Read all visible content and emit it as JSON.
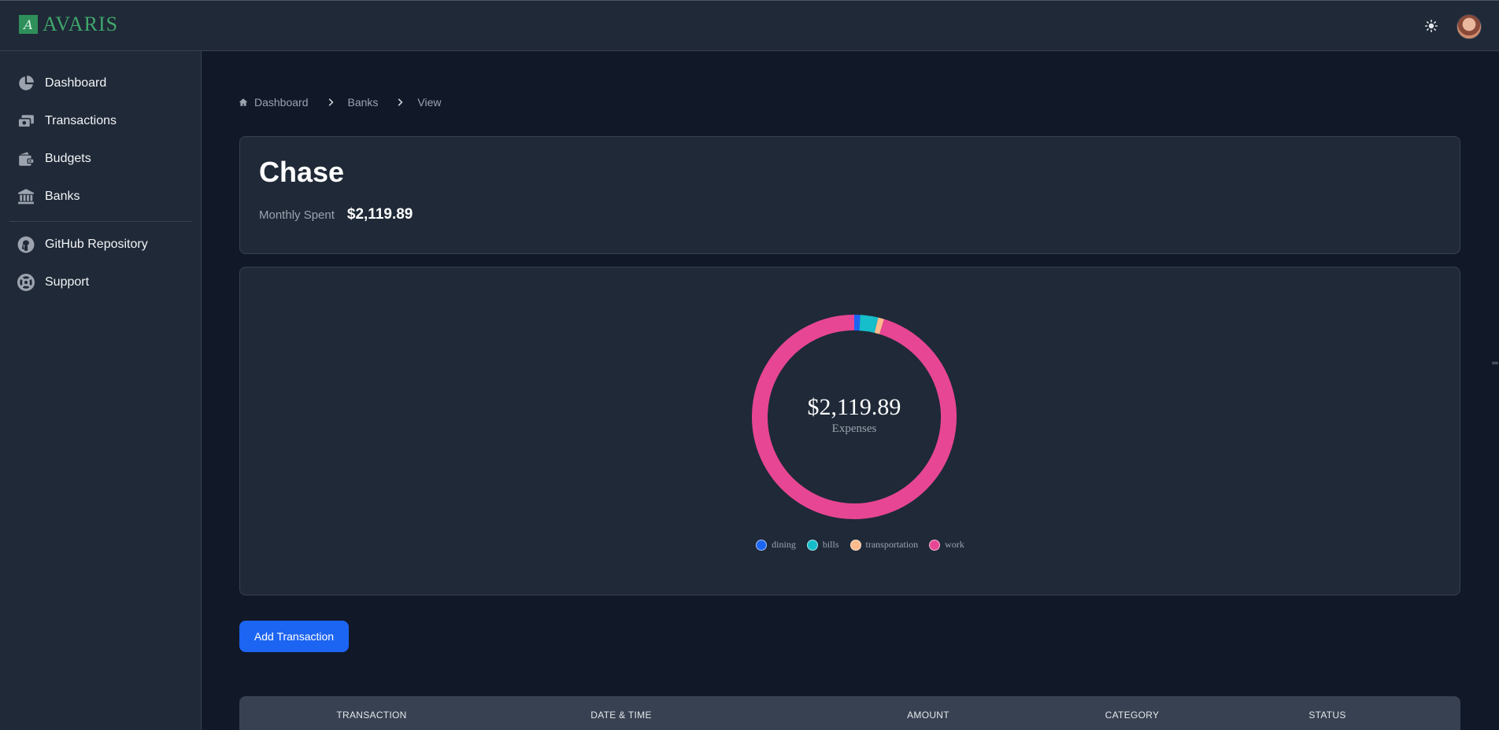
{
  "app": {
    "logo_letter": "A",
    "name": "AVARIS"
  },
  "sidebar": {
    "items": [
      {
        "label": "Dashboard",
        "icon": "pie-chart-icon"
      },
      {
        "label": "Transactions",
        "icon": "cash-icon"
      },
      {
        "label": "Budgets",
        "icon": "wallet-icon"
      },
      {
        "label": "Banks",
        "icon": "bank-icon"
      }
    ],
    "secondary": [
      {
        "label": "GitHub Repository",
        "icon": "github-icon"
      },
      {
        "label": "Support",
        "icon": "lifebuoy-icon"
      }
    ]
  },
  "breadcrumb": [
    "Dashboard",
    "Banks",
    "View"
  ],
  "bank": {
    "name": "Chase",
    "monthly_label": "Monthly Spent",
    "monthly_value": "$2,119.89"
  },
  "chart_data": {
    "type": "pie",
    "center_value": "$2,119.89",
    "center_label": "Expenses",
    "categories": [
      "dining",
      "bills",
      "transportation",
      "work"
    ],
    "values": [
      20,
      60,
      20,
      2019.89
    ],
    "colors": [
      "#1c64f2",
      "#16bdca",
      "#fdba8c",
      "#e74694"
    ],
    "legend_position": "bottom"
  },
  "actions": {
    "add_transaction": "Add Transaction"
  },
  "table": {
    "headers": [
      "Transaction",
      "Date & Time",
      "Amount",
      "Category",
      "Status"
    ]
  }
}
